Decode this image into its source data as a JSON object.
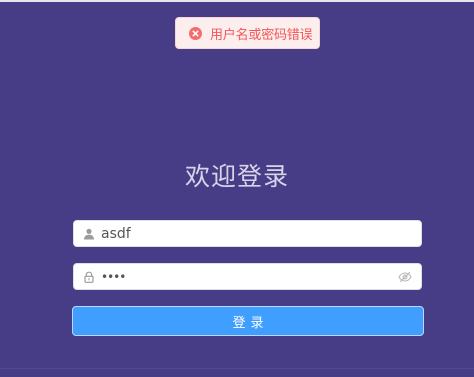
{
  "error_toast": {
    "message": "用户名或密码错误",
    "icon": "error-circle-icon",
    "text_color": "#f25757",
    "background": "#fdeeee"
  },
  "login": {
    "title": "欢迎登录",
    "username": {
      "value": "asdf",
      "icon": "user-icon"
    },
    "password": {
      "value": "••••",
      "icon": "lock-icon",
      "toggle_icon": "eye-off-icon"
    },
    "submit_label": "登录"
  },
  "colors": {
    "background": "#473d87",
    "button": "#409eff",
    "title": "#d8d4e8"
  }
}
